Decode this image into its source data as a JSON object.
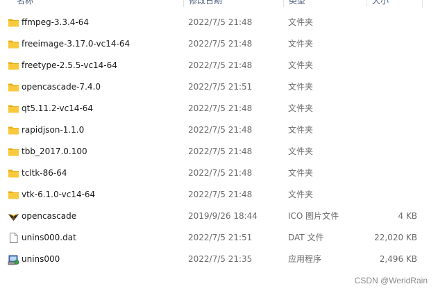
{
  "header": {
    "name_label": "名称",
    "date_label": "修改日期",
    "type_label": "类型",
    "size_label": "大小"
  },
  "files": [
    {
      "name": "ffmpeg-3.3.4-64",
      "date": "2022/7/5 21:48",
      "type": "文件夹",
      "size": "",
      "icon": "folder-icon"
    },
    {
      "name": "freeimage-3.17.0-vc14-64",
      "date": "2022/7/5 21:48",
      "type": "文件夹",
      "size": "",
      "icon": "folder-icon"
    },
    {
      "name": "freetype-2.5.5-vc14-64",
      "date": "2022/7/5 21:48",
      "type": "文件夹",
      "size": "",
      "icon": "folder-icon"
    },
    {
      "name": "opencascade-7.4.0",
      "date": "2022/7/5 21:51",
      "type": "文件夹",
      "size": "",
      "icon": "folder-icon"
    },
    {
      "name": "qt5.11.2-vc14-64",
      "date": "2022/7/5 21:48",
      "type": "文件夹",
      "size": "",
      "icon": "folder-icon"
    },
    {
      "name": "rapidjson-1.1.0",
      "date": "2022/7/5 21:48",
      "type": "文件夹",
      "size": "",
      "icon": "folder-icon"
    },
    {
      "name": "tbb_2017.0.100",
      "date": "2022/7/5 21:48",
      "type": "文件夹",
      "size": "",
      "icon": "folder-icon"
    },
    {
      "name": "tcltk-86-64",
      "date": "2022/7/5 21:48",
      "type": "文件夹",
      "size": "",
      "icon": "folder-icon"
    },
    {
      "name": "vtk-6.1.0-vc14-64",
      "date": "2022/7/5 21:48",
      "type": "文件夹",
      "size": "",
      "icon": "folder-icon"
    },
    {
      "name": "opencascade",
      "date": "2019/9/26 18:44",
      "type": "ICO 图片文件",
      "size": "4 KB",
      "icon": "opencascade-logo-icon"
    },
    {
      "name": "unins000.dat",
      "date": "2022/7/5 21:51",
      "type": "DAT 文件",
      "size": "22,020 KB",
      "icon": "blank-file-icon"
    },
    {
      "name": "unins000",
      "date": "2022/7/5 21:35",
      "type": "应用程序",
      "size": "2,496 KB",
      "icon": "installer-app-icon"
    }
  ],
  "watermark": "CSDN @WeridRain",
  "colors": {
    "folder": "#f8c93c",
    "folder_shade": "#e6ad14",
    "text_primary": "#1a1a1a",
    "text_secondary": "#6b6b6b"
  }
}
